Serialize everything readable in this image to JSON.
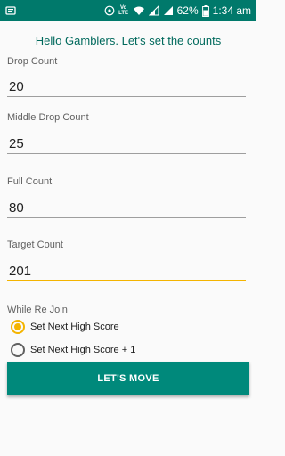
{
  "status_bar": {
    "battery_percent": "62%",
    "time": "1:34 am",
    "volte": "Vo LTE",
    "icons": [
      "notification-icon",
      "whatsapp-icon",
      "bluetooth-icon",
      "wifi-icon",
      "signal-icon",
      "signal-icon-2",
      "battery-icon"
    ]
  },
  "heading": "Hello Gamblers. Let's set the counts",
  "fields": [
    {
      "label": "Drop Count",
      "value": "20"
    },
    {
      "label": "Middle Drop Count",
      "value": "25"
    },
    {
      "label": "Full Count",
      "value": "80"
    },
    {
      "label": "Target Count",
      "value": "201"
    }
  ],
  "rejoin": {
    "label": "While Re Join",
    "options": [
      {
        "label": "Set Next High Score",
        "checked": true
      },
      {
        "label": "Set Next High Score + 1",
        "checked": false
      }
    ]
  },
  "button_label": "LET'S MOVE",
  "colors": {
    "status_bar": "#00796b",
    "accent": "#f4b400",
    "button": "#00897b",
    "heading": "#00695c"
  }
}
